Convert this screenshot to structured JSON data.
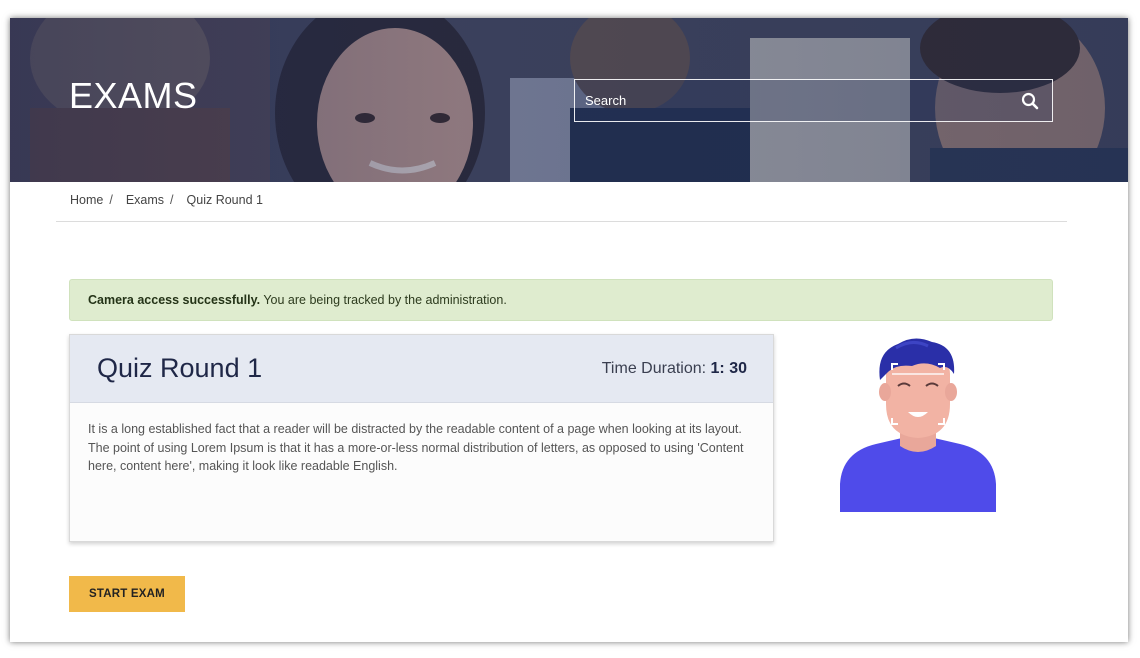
{
  "header": {
    "title": "EXAMS",
    "search": {
      "placeholder": "Search",
      "value": "",
      "icon": "search-icon"
    }
  },
  "breadcrumb": {
    "items": [
      "Home",
      "Exams",
      "Quiz Round 1"
    ],
    "separator": "/"
  },
  "alert": {
    "strong": "Camera access successfully.",
    "text": "You are being tracked by the administration.",
    "color": "#dfeccf"
  },
  "quiz": {
    "title": "Quiz Round 1",
    "duration_label": "Time Duration:",
    "duration_value": "1: 30",
    "description": "It is a long established fact that a reader will be distracted by the readable content of a page when looking at its layout. The point of using Lorem Ipsum is that it has a more-or-less normal distribution of letters, as opposed to using 'Content here, content here', making it look like readable English."
  },
  "actions": {
    "start_label": "START EXAM",
    "start_color": "#f1b94a"
  },
  "colors": {
    "accent_navy": "#1f2747",
    "avatar_shirt": "#4f4bea",
    "avatar_hair": "#2a2fa8"
  }
}
